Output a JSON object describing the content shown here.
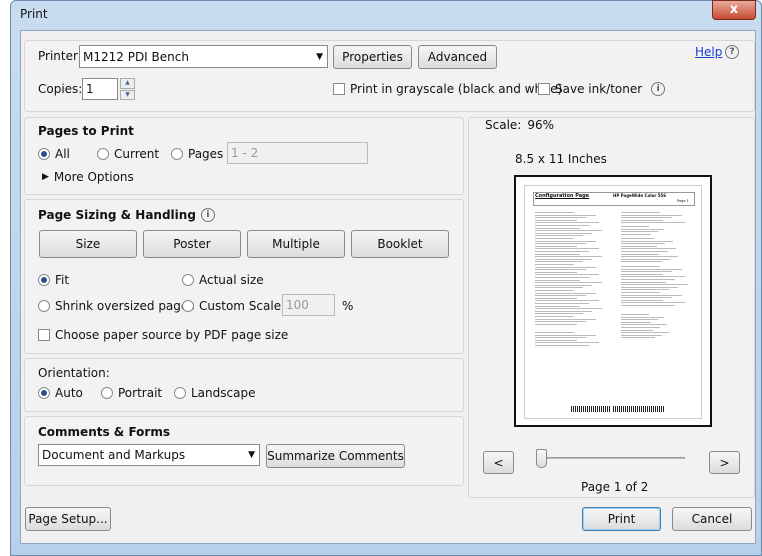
{
  "window": {
    "title": "Print",
    "close_glyph": "x"
  },
  "printer": {
    "label": "Printer:",
    "value": "M1212 PDI Bench",
    "properties": "Properties",
    "advanced": "Advanced",
    "help": "Help"
  },
  "copies": {
    "label": "Copies:",
    "value": "1"
  },
  "options": {
    "grayscale": "Print in grayscale (black and white)",
    "save_ink": "Save ink/toner"
  },
  "pages": {
    "heading": "Pages to Print",
    "all": "All",
    "current": "Current",
    "pages": "Pages",
    "range": "1 - 2",
    "more": "More Options"
  },
  "sizing": {
    "heading": "Page Sizing & Handling",
    "size": "Size",
    "poster": "Poster",
    "multiple": "Multiple",
    "booklet": "Booklet",
    "fit": "Fit",
    "actual": "Actual size",
    "shrink": "Shrink oversized pages",
    "custom": "Custom Scale:",
    "scale": "100",
    "pct": "%",
    "paper_source": "Choose paper source by PDF page size"
  },
  "orientation": {
    "heading": "Orientation:",
    "auto": "Auto",
    "portrait": "Portrait",
    "landscape": "Landscape"
  },
  "comments": {
    "heading": "Comments & Forms",
    "value": "Document and Markups",
    "summarize": "Summarize Comments"
  },
  "preview": {
    "scale_label": "Scale:",
    "scale": "96%",
    "paper": "8.5 x 11 Inches",
    "doc_title": "Configuration Page",
    "doc_model": "HP PageWide Color 556",
    "doc_page": "Page 1",
    "prev": "<",
    "next": ">",
    "page_status": "Page 1 of 2",
    "slider_value": 0
  },
  "footer": {
    "page_setup": "Page Setup...",
    "print": "Print",
    "cancel": "Cancel"
  }
}
